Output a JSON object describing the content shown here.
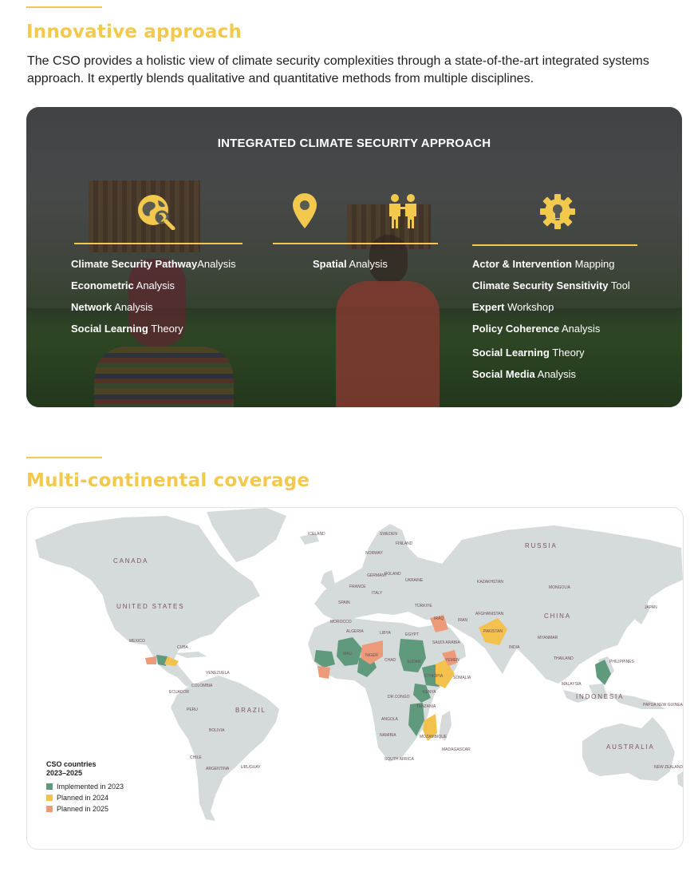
{
  "innovative": {
    "heading": "Innovative approach",
    "intro": "The CSO provides a holistic view of climate security complexities through a state-of-the-art integrated systems approach. It expertly blends qualitative and quantitative methods from multiple disciplines."
  },
  "approach": {
    "title": "INTEGRATED CLIMATE SECURITY APPROACH",
    "columns": [
      {
        "icon": "globe-search-icon",
        "items": [
          {
            "bold": "Climate Security Pathway",
            "rest": "Analysis"
          },
          {
            "bold": "Econometric",
            "rest": " Analysis"
          },
          {
            "bold": "Network",
            "rest": " Analysis"
          },
          {
            "bold": "Social Learning",
            "rest": " Theory"
          }
        ]
      },
      {
        "icon": "map-pin-icon",
        "icon2": "people-icon",
        "items": [
          {
            "bold": "Spatial",
            "rest": " Analysis"
          }
        ]
      },
      {
        "icon": "gear-lightbulb-icon",
        "items": [
          {
            "bold": "Actor & Intervention",
            "rest": " Mapping"
          },
          {
            "bold": "Climate Security Sensitivity",
            "rest": " Tool"
          },
          {
            "bold": "Expert",
            "rest": " Workshop"
          },
          {
            "bold": "Policy Coherence",
            "rest": " Analysis"
          },
          {
            "bold": "Social Learning",
            "rest": " Theory"
          },
          {
            "bold": "Social Media",
            "rest": " Analysis"
          }
        ]
      }
    ]
  },
  "coverage": {
    "heading": "Multi-continental coverage",
    "map_labels": {
      "canada": "CANADA",
      "united_states": "UNITED STATES",
      "brazil": "BRAZIL",
      "russia": "RUSSIA",
      "china": "CHINA",
      "kazakhstan": "KAZAKHSTAN",
      "mongolia": "MONGOLIA",
      "indonesia": "INDONESIA",
      "australia": "AUSTRALIA",
      "mexico": "MEXICO",
      "cuba": "CUBA",
      "colombia": "COLOMBIA",
      "ecuador": "ECUADOR",
      "peru": "PERU",
      "bolivia": "BOLIVIA",
      "chile": "CHILE",
      "argentina": "ARGENTINA",
      "uruguay": "URUGUAY",
      "venezuela": "VENEZUELA",
      "spain": "SPAIN",
      "france": "FRANCE",
      "germany": "GERMANY",
      "poland": "POLAND",
      "ukraine": "UKRAINE",
      "norway": "NORWAY",
      "sweden": "SWEDEN",
      "finland": "FINLAND",
      "iceland": "ICELAND",
      "italy": "ITALY",
      "turkiye": "TÜRKIYE",
      "algeria": "ALGERIA",
      "libya": "LIBYA",
      "egypt": "EGYPT",
      "morocco": "MOROCCO",
      "mali": "MALI",
      "niger": "NIGER",
      "chad": "CHAD",
      "sudan": "SUDAN",
      "ethiopia": "ETHIOPIA",
      "somalia": "SOMALIA",
      "kenya": "KENYA",
      "dr_congo": "DR CONGO",
      "tanzania": "TANZANIA",
      "angola": "ANGOLA",
      "namibia": "NAMIBIA",
      "south_africa": "SOUTH AFRICA",
      "madagascar": "MADAGASCAR",
      "mozambique": "MOZAMBIQUE",
      "saudi_arabia": "SAUDI ARABIA",
      "iraq": "IRAQ",
      "iran": "IRAN",
      "yemen": "YEMEN",
      "pakistan": "PAKISTAN",
      "afghanistan": "AFGHANISTAN",
      "india": "INDIA",
      "myanmar": "MYANMAR",
      "thailand": "THAILAND",
      "philippines": "PHILIPPINES",
      "malaysia": "MALAYSIA",
      "japan": "JAPAN",
      "papua_new_guinea": "PAPUA NEW GUINEA",
      "new_zealand": "NEW ZEALAND"
    },
    "legend": {
      "title_line1": "CSO countries",
      "title_line2": "2023–2025",
      "items": [
        {
          "label": "Implemented in 2023",
          "color": "#5f9a7d"
        },
        {
          "label": "Planned in 2024",
          "color": "#f2c14e"
        },
        {
          "label": "Planned in 2025",
          "color": "#ec9a78"
        }
      ]
    },
    "colors": {
      "land": "#d5dadb",
      "implemented": "#5f9a7d",
      "planned_2024": "#f2c14e",
      "planned_2025": "#ec9a78",
      "accent": "#f2c94c"
    }
  }
}
